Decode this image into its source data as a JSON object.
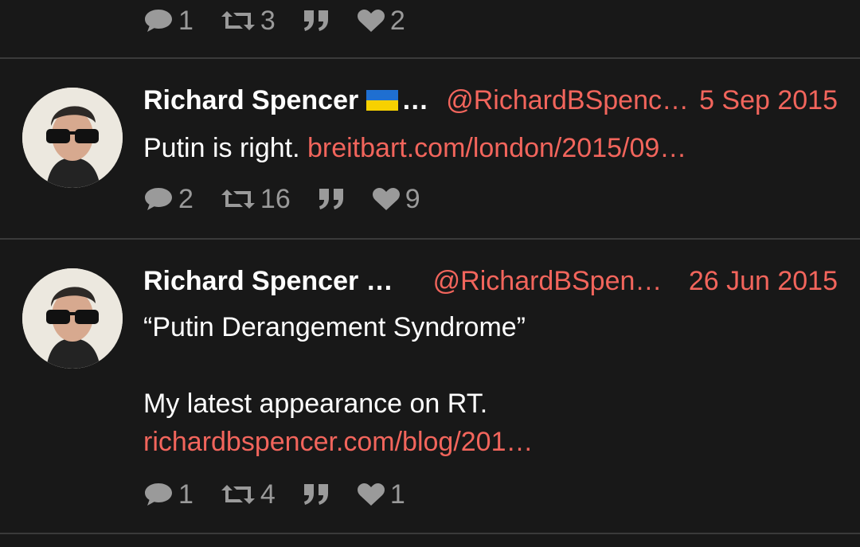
{
  "top_actions": {
    "replies": "1",
    "retweets": "3",
    "likes": "2"
  },
  "tweets": [
    {
      "name": "Richard Spencer",
      "name_suffix": "…",
      "handle": "@RichardBSpenc…",
      "date": "5 Sep 2015",
      "text": "Putin is right.",
      "link": "breitbart.com/london/2015/09…",
      "replies": "2",
      "retweets": "16",
      "likes": "9"
    },
    {
      "name": "Richard Spencer …",
      "handle": "@RichardBSpen…",
      "date": "26 Jun 2015",
      "text_line1": "“Putin Derangement Syndrome”",
      "text_line2": "My latest appearance on RT.",
      "link": "richardbspencer.com/blog/201…",
      "replies": "1",
      "retweets": "4",
      "likes": "1"
    }
  ],
  "colors": {
    "background": "#181818",
    "accent": "#f2655c",
    "muted": "#9a9a9a",
    "divider": "#3a3a3a"
  },
  "icons": [
    "reply-icon",
    "retweet-icon",
    "quote-icon",
    "like-icon",
    "ukraine-flag-icon",
    "avatar"
  ]
}
